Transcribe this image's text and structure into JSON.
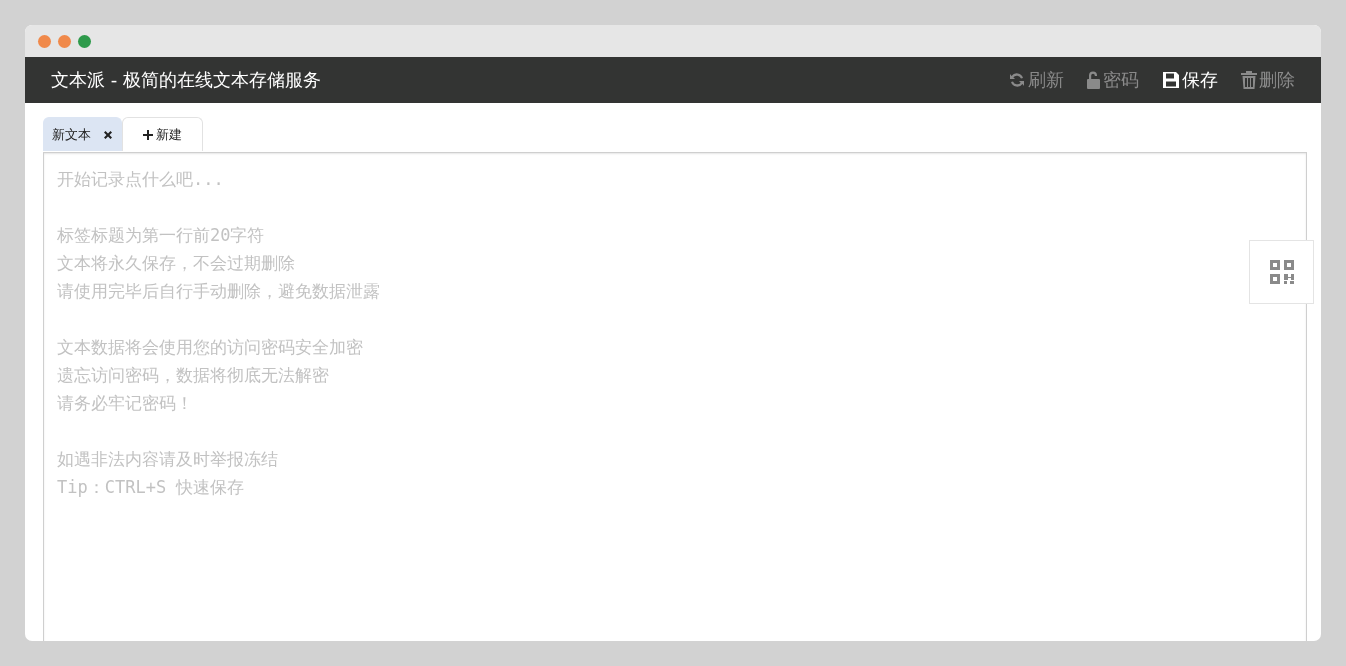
{
  "window": {
    "title": "文本派 - 极简的在线文本存储服务"
  },
  "toolbar": [
    {
      "kind": "refresh",
      "label": "刷新",
      "disabled": true
    },
    {
      "kind": "lock",
      "label": "密码",
      "disabled": true
    },
    {
      "kind": "save",
      "label": "保存",
      "disabled": false
    },
    {
      "kind": "delete",
      "label": "删除",
      "disabled": true
    }
  ],
  "tabs": [
    {
      "kind": "document",
      "label": "新文本",
      "selected": true
    },
    {
      "kind": "new",
      "label": "新建",
      "selected": false
    }
  ],
  "editor": {
    "placeholder_paragraphs": [
      [
        "开始记录点什么吧..."
      ],
      [
        "标签标题为第一行前20字符",
        "文本将永久保存，不会过期删除",
        "请使用完毕后自行手动删除，避免数据泄露"
      ],
      [
        "文本数据将会使用您的访问密码安全加密",
        "遗忘访问密码，数据将彻底无法解密",
        "请务必牢记密码！"
      ],
      [
        "如遇非法内容请及时举报冻结",
        "Tip：CTRL+S 快速保存"
      ]
    ]
  }
}
